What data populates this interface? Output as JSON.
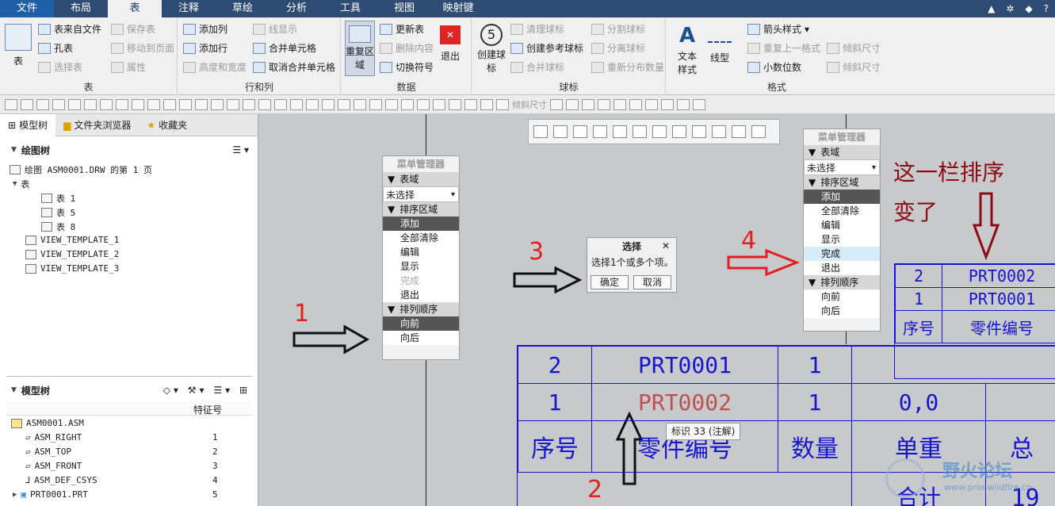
{
  "menubar": {
    "tabs": [
      "文件",
      "布局",
      "表",
      "注释",
      "草绘",
      "分析",
      "工具",
      "视图",
      "映射键"
    ],
    "active_index": 2
  },
  "ribbon": {
    "groups": {
      "table": {
        "name": "表",
        "big_label": "表",
        "items": [
          "表来自文件",
          "孔表",
          "选择表",
          "保存表",
          "移动到页面",
          "属性"
        ]
      },
      "rows_cols": {
        "name": "行和列",
        "items": [
          "添加列",
          "添加行",
          "高度和宽度",
          "线显示",
          "合并单元格",
          "取消合并单元格"
        ]
      },
      "data": {
        "name": "数据",
        "big_label": "重复区域",
        "items": [
          "更新表",
          "删除内容",
          "切换符号"
        ],
        "exit_label": "退出"
      },
      "balloon": {
        "name": "球标",
        "big_label": "创建球标",
        "items": [
          "清理球标",
          "创建参考球标",
          "合并球标",
          "分割球标",
          "分离球标",
          "重新分布数量"
        ]
      },
      "format": {
        "name": "格式",
        "big1": "文本样式",
        "big2": "线型",
        "items": [
          "箭头样式",
          "重复上一格式",
          "小数位数",
          "倾斜尺寸",
          "倾斜尺寸"
        ]
      }
    }
  },
  "toolbar2": {
    "skew_label": "倾斜尺寸"
  },
  "left_panel": {
    "tabs": [
      "模型树",
      "文件夹浏览器",
      "收藏夹"
    ],
    "drawing_tree_title": "绘图树",
    "drawing_nodes": [
      "绘图 ASM0001.DRW 的第 1 页",
      "表",
      "表 1",
      "表 5",
      "表 8",
      "VIEW_TEMPLATE_1",
      "VIEW_TEMPLATE_2",
      "VIEW_TEMPLATE_3"
    ],
    "model_tree_title": "模型树",
    "col_header": "特征号",
    "model_nodes": [
      {
        "name": "ASM0001.ASM",
        "num": ""
      },
      {
        "name": "ASM_RIGHT",
        "num": "1"
      },
      {
        "name": "ASM_TOP",
        "num": "2"
      },
      {
        "name": "ASM_FRONT",
        "num": "3"
      },
      {
        "name": "ASM_DEF_CSYS",
        "num": "4"
      },
      {
        "name": "PRT0001.PRT",
        "num": "5"
      }
    ]
  },
  "menu_manager_1": {
    "title": "菜单管理器",
    "sec1": "表域",
    "select_value": "未选择",
    "sec2": "排序区域",
    "items": [
      "添加",
      "全部清除",
      "编辑",
      "显示",
      "完成",
      "退出"
    ],
    "sec3": "排列顺序",
    "order_items": [
      "向前",
      "向后"
    ]
  },
  "menu_manager_2": {
    "title": "菜单管理器",
    "sec1": "表域",
    "select_value": "未选择",
    "sec2": "排序区域",
    "items": [
      "添加",
      "全部清除",
      "编辑",
      "显示",
      "完成",
      "退出"
    ],
    "sec3": "排列顺序",
    "order_items": [
      "向前",
      "向后"
    ]
  },
  "select_dialog": {
    "title": "选择",
    "message": "选择1个或多个项。",
    "ok": "确定",
    "cancel": "取消"
  },
  "tooltip": "标识 33 (注解)",
  "annotations": {
    "n1": "1",
    "n2": "2",
    "n3": "3",
    "n4": "4",
    "note_line1": "这一栏排序",
    "note_line2": "变了"
  },
  "bom_table_main": {
    "rows": [
      {
        "no": "2",
        "part": "PRT0001",
        "qty": "1"
      },
      {
        "no": "1",
        "part": "PRT0002",
        "qty": "1",
        "weight": "0,0"
      }
    ],
    "headers": [
      "序号",
      "零件编号",
      "数量",
      "单重",
      "总"
    ],
    "footer": "合计",
    "footer_value": "19"
  },
  "bom_table_right": {
    "rows": [
      {
        "no": "2",
        "part": "PRT0002"
      },
      {
        "no": "1",
        "part": "PRT0001"
      }
    ],
    "headers": [
      "序号",
      "零件编号"
    ]
  },
  "watermark": {
    "text": "野火论坛",
    "url": "www.proewildfire.cn"
  },
  "colors": {
    "menubar": "#2e4c73",
    "table_line": "#1515d0",
    "annotation_red": "#e02020",
    "note_dark_red": "#8b0b14",
    "highlight_text": "#c0504d"
  }
}
